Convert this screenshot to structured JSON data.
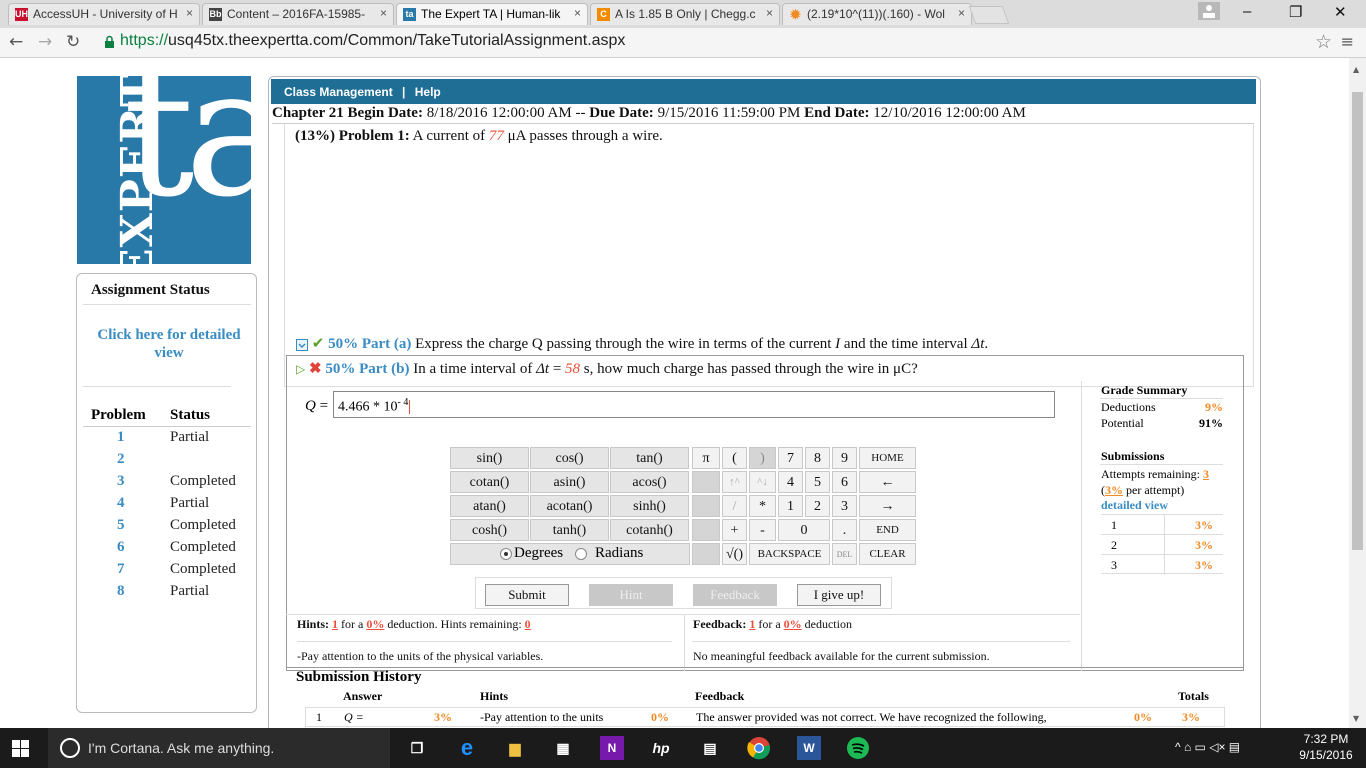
{
  "browser": {
    "tabs": [
      {
        "label": "AccessUH - University of H",
        "favicon": "UH",
        "color": "#c8102e"
      },
      {
        "label": "Content – 2016FA-15985-",
        "favicon": "Bb",
        "color": "#444444"
      },
      {
        "label": "The Expert TA | Human-lik",
        "favicon": "ta",
        "color": "#2878a8"
      },
      {
        "label": "A Is 1.85 B Only | Chegg.c",
        "favicon": "C",
        "color": "#f28b00"
      },
      {
        "label": "(2.19*10^(11))(.160) - Wol",
        "favicon": "✹",
        "color": "#f08a24"
      }
    ],
    "url_prefix": "https://",
    "url_rest": "usq45tx.theexpertta.com/Common/TakeTutorialAssignment.aspx",
    "close_glyph": "×",
    "window_controls": {
      "min": "–",
      "max": "❐",
      "close": "✕"
    }
  },
  "logo": {
    "expert": "EXPERT",
    "ta": "ta"
  },
  "sidebar": {
    "title": "Assignment Status",
    "detail_link": "Click here for detailed view",
    "header_problem": "Problem",
    "header_status": "Status",
    "rows": [
      {
        "num": "1",
        "status": "Partial"
      },
      {
        "num": "2",
        "status": ""
      },
      {
        "num": "3",
        "status": "Completed"
      },
      {
        "num": "4",
        "status": "Partial"
      },
      {
        "num": "5",
        "status": "Completed"
      },
      {
        "num": "6",
        "status": "Completed"
      },
      {
        "num": "7",
        "status": "Completed"
      },
      {
        "num": "8",
        "status": "Partial"
      }
    ]
  },
  "topnav": {
    "class_management": "Class Management",
    "sep": "|",
    "help": "Help"
  },
  "chapter": {
    "begin_label": "Chapter 21 Begin Date:",
    "begin": "8/18/2016 12:00:00 AM",
    "dash": "--",
    "due_label": "Due Date:",
    "due": "9/15/2016 11:59:00 PM",
    "end_label": "End Date:",
    "end": "12/10/2016 12:00:00 AM"
  },
  "problem": {
    "label": "(13%) Problem 1:",
    "text_before": "A current of",
    "value": "77",
    "text_after": "μA passes through a wire."
  },
  "part_a": {
    "label": "50% Part (a)",
    "text": "Express the charge Q passing through the wire in terms of the current",
    "var1": "I",
    "mid": "and the time interval",
    "var2": "Δt",
    "end": "."
  },
  "part_b": {
    "label": "50% Part (b)",
    "text_before": "In a time interval of",
    "var": "Δt",
    "eq": "=",
    "value": "58",
    "text_after": "s, how much charge has passed through the wire in μC?"
  },
  "answer": {
    "label": "Q",
    "eq": "=",
    "value": "4.466 * 10",
    "exp": "- 4"
  },
  "keypad": {
    "functions": [
      "sin()",
      "cos()",
      "tan()",
      "cotan()",
      "asin()",
      "acos()",
      "atan()",
      "acotan()",
      "sinh()",
      "cosh()",
      "tanh()",
      "cotanh()"
    ],
    "degrees": "Degrees",
    "radians": "Radians",
    "selected_unit": "Degrees",
    "row1": [
      "π",
      "(",
      ")",
      "7",
      "8",
      "9",
      "HOME"
    ],
    "row2": [
      "",
      "↑^",
      "^↓",
      "4",
      "5",
      "6",
      "←"
    ],
    "row3": [
      "",
      "/",
      "*",
      "1",
      "2",
      "3",
      "→"
    ],
    "row4": [
      "",
      "+",
      "-",
      "0",
      ".",
      "END"
    ],
    "row5": [
      "",
      "√()",
      "BACKSPACE",
      "DEL",
      "CLEAR"
    ]
  },
  "actions": {
    "submit": "Submit",
    "hint": "Hint",
    "feedback": "Feedback",
    "giveup": "I give up!"
  },
  "hints": {
    "label": "Hints:",
    "count": "1",
    "for_a": "for a",
    "pct": "0%",
    "deduction": "deduction. Hints remaining:",
    "remaining": "0",
    "text": "-Pay attention to the units of the physical variables."
  },
  "feedback": {
    "label": "Feedback:",
    "count": "1",
    "for_a": "for a",
    "pct": "0%",
    "deduction": "deduction",
    "text": "No meaningful feedback available for the current submission."
  },
  "grade_summary": {
    "title": "Grade Summary",
    "deductions_label": "Deductions",
    "deductions": "9%",
    "potential_label": "Potential",
    "potential": "91%",
    "submissions_title": "Submissions",
    "attempts_label": "Attempts remaining:",
    "attempts": "3",
    "per_attempt_pct": "3%",
    "per_attempt_text": "per attempt)",
    "detail": "detailed view",
    "rows": [
      {
        "n": "1",
        "v": "3%"
      },
      {
        "n": "2",
        "v": "3%"
      },
      {
        "n": "3",
        "v": "3%"
      }
    ]
  },
  "history": {
    "title": "Submission History",
    "headers": {
      "answer": "Answer",
      "hints": "Hints",
      "feedback": "Feedback",
      "totals": "Totals"
    },
    "row": {
      "n": "1",
      "answer": "Q =",
      "ans_pct": "3%",
      "hint": "-Pay attention to the units",
      "hint_pct": "0%",
      "feedback": "The answer provided was not correct. We have recognized the following,",
      "fb_pct": "0%",
      "total": "3%"
    }
  },
  "taskbar": {
    "cortana": "I'm Cortana. Ask me anything.",
    "time": "7:32 PM",
    "date": "9/15/2016",
    "tray": "^  ⌂  ▭  ◁×  ▤"
  }
}
